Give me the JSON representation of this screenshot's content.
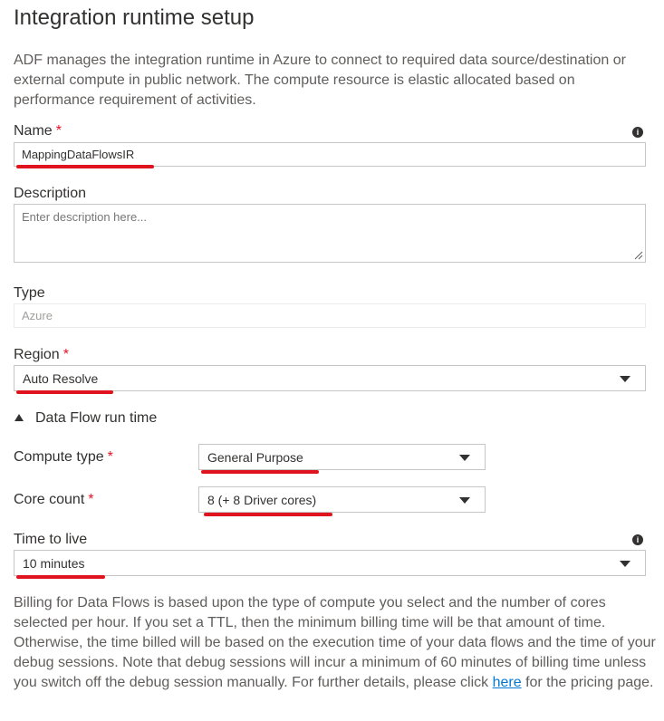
{
  "page": {
    "title": "Integration runtime setup",
    "description": "ADF manages the integration runtime in Azure to connect to required data source/destination or external compute in public network. The compute resource is elastic allocated based on performance requirement of activities."
  },
  "fields": {
    "name": {
      "label": "Name",
      "required_mark": "*",
      "value": "MappingDataFlowsIR"
    },
    "description": {
      "label": "Description",
      "placeholder": "Enter description here..."
    },
    "type": {
      "label": "Type",
      "value": "Azure"
    },
    "region": {
      "label": "Region",
      "required_mark": "*",
      "value": "Auto Resolve"
    }
  },
  "data_flow": {
    "section_label": "Data Flow run time",
    "compute_type": {
      "label": "Compute type",
      "required_mark": "*",
      "value": "General Purpose"
    },
    "core_count": {
      "label": "Core count",
      "required_mark": "*",
      "value": "8 (+ 8 Driver cores)"
    },
    "time_to_live": {
      "label": "Time to live",
      "value": "10 minutes"
    }
  },
  "billing": {
    "text": "Billing for Data Flows is based upon the type of compute you select and the number of cores selected per hour. If you set a TTL, then the minimum billing time will be that amount of time. Otherwise, the time billed will be based on the execution time of your data flows and the time of your debug sessions. Note that debug sessions will incur a minimum of 60 minutes of billing time unless you switch off the debug session manually. For further details, please click",
    "link_text": "here",
    "suffix": "for the pricing page."
  },
  "icons": {
    "info": "info-icon",
    "dropdown": "chevron-down-icon",
    "collapse": "triangle-up-icon"
  },
  "colors": {
    "required": "#e81123",
    "highlight_underline": "#e0141e",
    "link": "#0078d4"
  }
}
